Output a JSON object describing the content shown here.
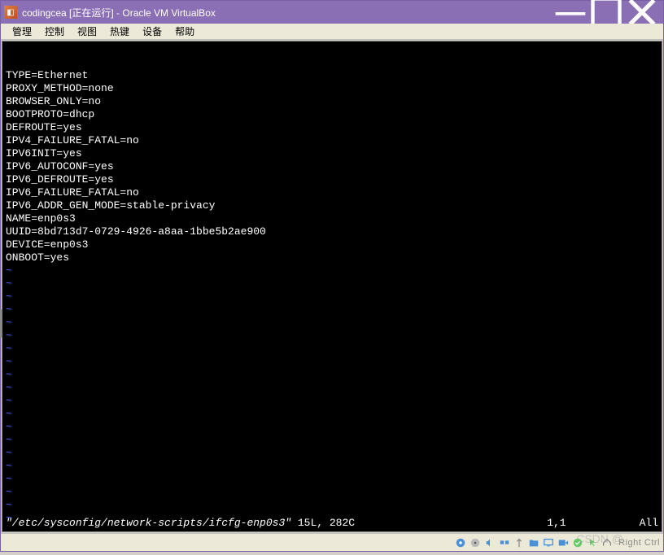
{
  "window": {
    "title": "codingcea [正在运行] - Oracle VM VirtualBox"
  },
  "menu": {
    "items": [
      "管理",
      "控制",
      "视图",
      "热键",
      "设备",
      "帮助"
    ]
  },
  "terminal": {
    "lines": [
      "TYPE=Ethernet",
      "PROXY_METHOD=none",
      "BROWSER_ONLY=no",
      "BOOTPROTO=dhcp",
      "DEFROUTE=yes",
      "IPV4_FAILURE_FATAL=no",
      "IPV6INIT=yes",
      "IPV6_AUTOCONF=yes",
      "IPV6_DEFROUTE=yes",
      "IPV6_FAILURE_FATAL=no",
      "IPV6_ADDR_GEN_MODE=stable-privacy",
      "NAME=enp0s3",
      "UUID=8bd713d7-0729-4926-a8aa-1bbe5b2ae900",
      "DEVICE=enp0s3",
      "ONBOOT=yes"
    ],
    "tilde_count": 20,
    "status": {
      "filename": "\"/etc/sysconfig/network-scripts/ifcfg-enp0s3\"",
      "info": " 15L, 282C",
      "position": "1,1",
      "scroll": "All"
    }
  },
  "tray": {
    "host_key": "Right Ctrl"
  },
  "watermark": "CSDN @"
}
